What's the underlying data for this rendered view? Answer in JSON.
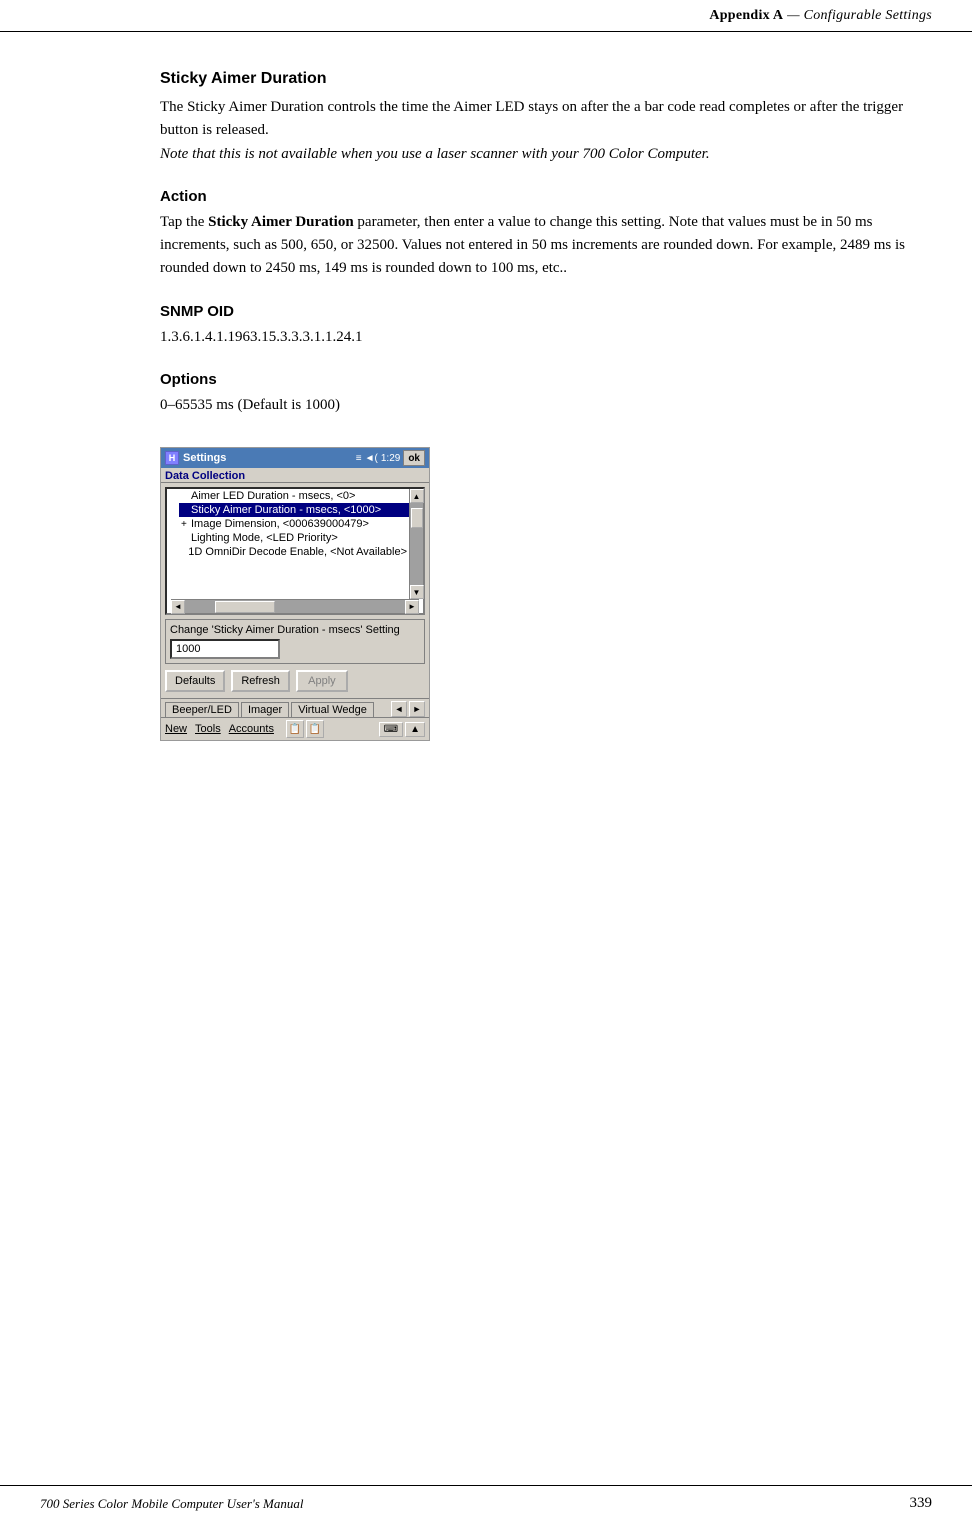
{
  "header": {
    "label": "Appendix A",
    "separator": "—",
    "title": "Configurable Settings"
  },
  "footer": {
    "left": "700 Series Color Mobile Computer User's Manual",
    "right": "339"
  },
  "content": {
    "section1": {
      "title": "Sticky Aimer Duration",
      "body1": "The Sticky Aimer Duration controls the time the Aimer LED stays on after the a bar code read completes or after the trigger button is released.",
      "body2": "Note that this is not available when you use a laser scanner with your 700 Color Computer."
    },
    "section2": {
      "title": "Action",
      "body": "Tap the Sticky Aimer Duration parameter, then enter a value to change this setting. Note that values must be in 50 ms increments, such as 500, 650, or 32500. Values not entered in 50 ms increments are rounded down. For example, 2489 ms is rounded down to 2450 ms, 149 ms is rounded down to 100 ms, etc..",
      "bold_phrase": "Sticky Aimer Duration"
    },
    "section3": {
      "title": "SNMP OID",
      "body": "1.3.6.1.4.1.1963.15.3.3.3.1.1.24.1"
    },
    "section4": {
      "title": "Options",
      "body": "0–65535 ms (Default is 1000)"
    }
  },
  "screenshot": {
    "titlebar": {
      "icon_label": "H",
      "title": "Settings",
      "status_icons": "≡ ◄(",
      "time": "1:29",
      "ok_label": "ok"
    },
    "section_tab": "Data Collection",
    "tree_items": [
      {
        "text": "Aimer LED Duration - msecs, <0>",
        "indent": 1,
        "selected": false,
        "expander": ""
      },
      {
        "text": "Sticky Aimer Duration - msecs, <1000>",
        "indent": 1,
        "selected": true,
        "expander": ""
      },
      {
        "text": "Image Dimension, <000639000479>",
        "indent": 1,
        "selected": false,
        "expander": "+"
      },
      {
        "text": "Lighting Mode, <LED Priority>",
        "indent": 1,
        "selected": false,
        "expander": ""
      },
      {
        "text": "1D OmniDir Decode Enable, <Not Available>",
        "indent": 1,
        "selected": false,
        "expander": ""
      }
    ],
    "settings_panel": {
      "label": "Change 'Sticky Aimer Duration - msecs' Setting",
      "input_value": "1000"
    },
    "buttons": {
      "defaults": "Defaults",
      "refresh": "Refresh",
      "apply": "Apply"
    },
    "tabs": [
      {
        "label": "Beeper/LED",
        "active": false
      },
      {
        "label": "Imager",
        "active": false
      },
      {
        "label": "Virtual Wedge",
        "active": false
      }
    ],
    "tab_nav": [
      "◄",
      "►"
    ],
    "menu_items": [
      "New",
      "Tools",
      "Accounts"
    ],
    "menu_icons": [
      "📋",
      "📋"
    ],
    "keyboard_label": "⌨",
    "scroll_up": "▲"
  }
}
